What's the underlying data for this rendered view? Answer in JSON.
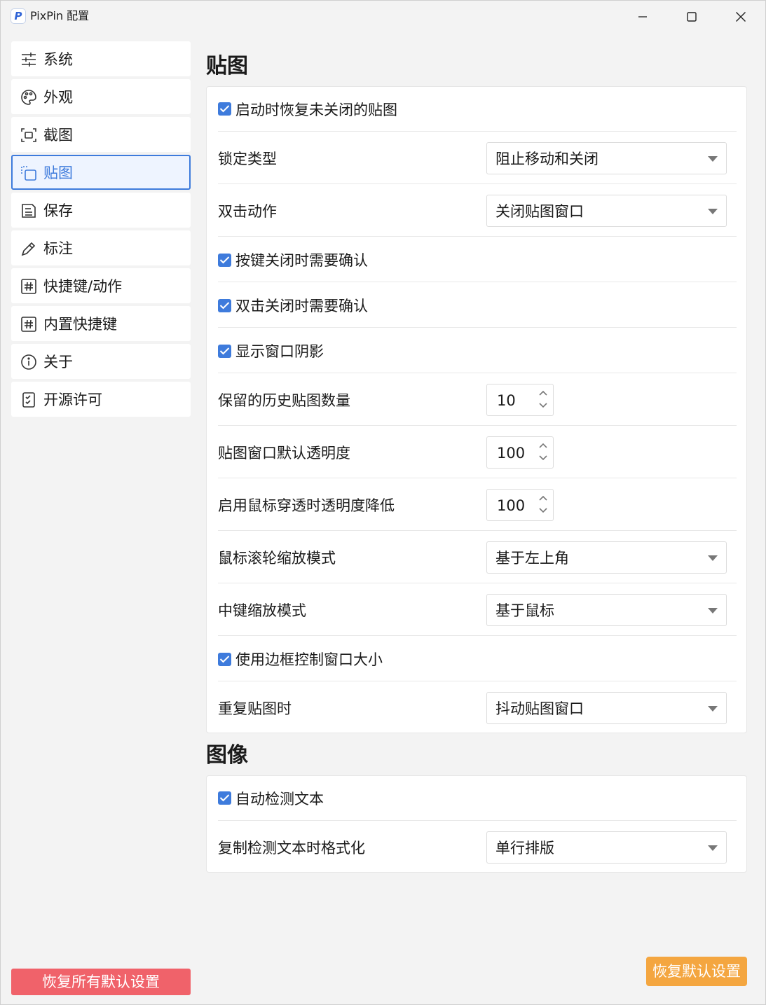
{
  "window": {
    "title": "PixPin 配置",
    "app_icon_letter": "P"
  },
  "sidebar": {
    "items": [
      {
        "label": "系统",
        "icon": "sliders-icon"
      },
      {
        "label": "外观",
        "icon": "palette-icon"
      },
      {
        "label": "截图",
        "icon": "screenshot-frame-icon"
      },
      {
        "label": "贴图",
        "icon": "pin-copy-icon",
        "active": true
      },
      {
        "label": "保存",
        "icon": "save-disk-icon"
      },
      {
        "label": "标注",
        "icon": "pencil-icon"
      },
      {
        "label": "快捷键/动作",
        "icon": "hashtag-icon"
      },
      {
        "label": "内置快捷键",
        "icon": "hashtag-icon"
      },
      {
        "label": "关于",
        "icon": "info-icon"
      },
      {
        "label": "开源许可",
        "icon": "license-clipboard-icon"
      }
    ],
    "reset_all_label": "恢复所有默认设置"
  },
  "pin_section": {
    "title": "贴图",
    "restore_on_start": "启动时恢复未关闭的贴图",
    "lock_type_label": "锁定类型",
    "lock_type_value": "阻止移动和关闭",
    "double_click_label": "双击动作",
    "double_click_value": "关闭贴图窗口",
    "key_close_confirm": "按键关闭时需要确认",
    "dblclick_close_confirm": "双击关闭时需要确认",
    "show_shadow": "显示窗口阴影",
    "history_count_label": "保留的历史贴图数量",
    "history_count_value": "10",
    "default_opacity_label": "贴图窗口默认透明度",
    "default_opacity_value": "100",
    "passthrough_opacity_label": "启用鼠标穿透时透明度降低",
    "passthrough_opacity_value": "100",
    "wheel_zoom_label": "鼠标滚轮缩放模式",
    "wheel_zoom_value": "基于左上角",
    "middle_zoom_label": "中键缩放模式",
    "middle_zoom_value": "基于鼠标",
    "border_resize": "使用边框控制窗口大小",
    "repeat_pin_label": "重复贴图时",
    "repeat_pin_value": "抖动贴图窗口"
  },
  "image_section": {
    "title": "图像",
    "auto_detect_text": "自动检测文本",
    "copy_format_label": "复制检测文本时格式化",
    "copy_format_value": "单行排版"
  },
  "footer": {
    "reset_default_label": "恢复默认设置"
  },
  "colors": {
    "accent": "#3e7bdc",
    "danger": "#f0626a",
    "warning": "#f4a640"
  }
}
